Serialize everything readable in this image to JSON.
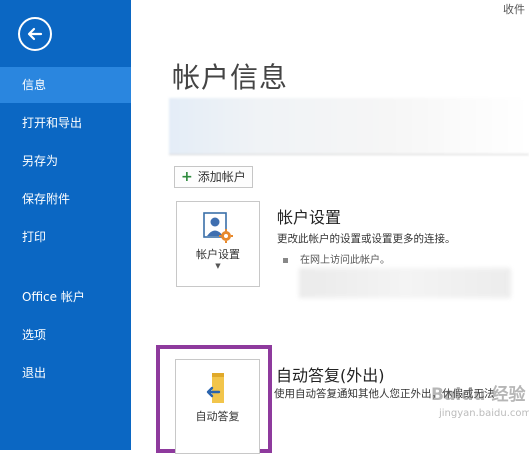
{
  "sidebar": {
    "items": [
      {
        "label": "信息"
      },
      {
        "label": "打开和导出"
      },
      {
        "label": "另存为"
      },
      {
        "label": "保存附件"
      },
      {
        "label": "打印"
      },
      {
        "label": "Office 帐户"
      },
      {
        "label": "选项"
      },
      {
        "label": "退出"
      }
    ]
  },
  "header": {
    "top_right": "收件"
  },
  "main": {
    "title": "帐户信息",
    "add_account": "添加帐户",
    "account_settings": {
      "tile_label": "帐户设置",
      "title": "帐户设置",
      "desc": "更改此帐户的设置或设置更多的连接。",
      "bullet": "在网上访问此帐户。"
    },
    "auto_reply": {
      "tile_label": "自动答复",
      "title": "自动答复(外出)",
      "desc": "使用自动答复通知其他人您正外出，休假或无法"
    }
  },
  "watermark": {
    "text": "Baidu 经验",
    "sub": "jingyan.baidu.com"
  },
  "colors": {
    "sidebar": "#0b67c3",
    "sidebar_active": "#2a86df",
    "highlight": "#8e3a9d"
  }
}
